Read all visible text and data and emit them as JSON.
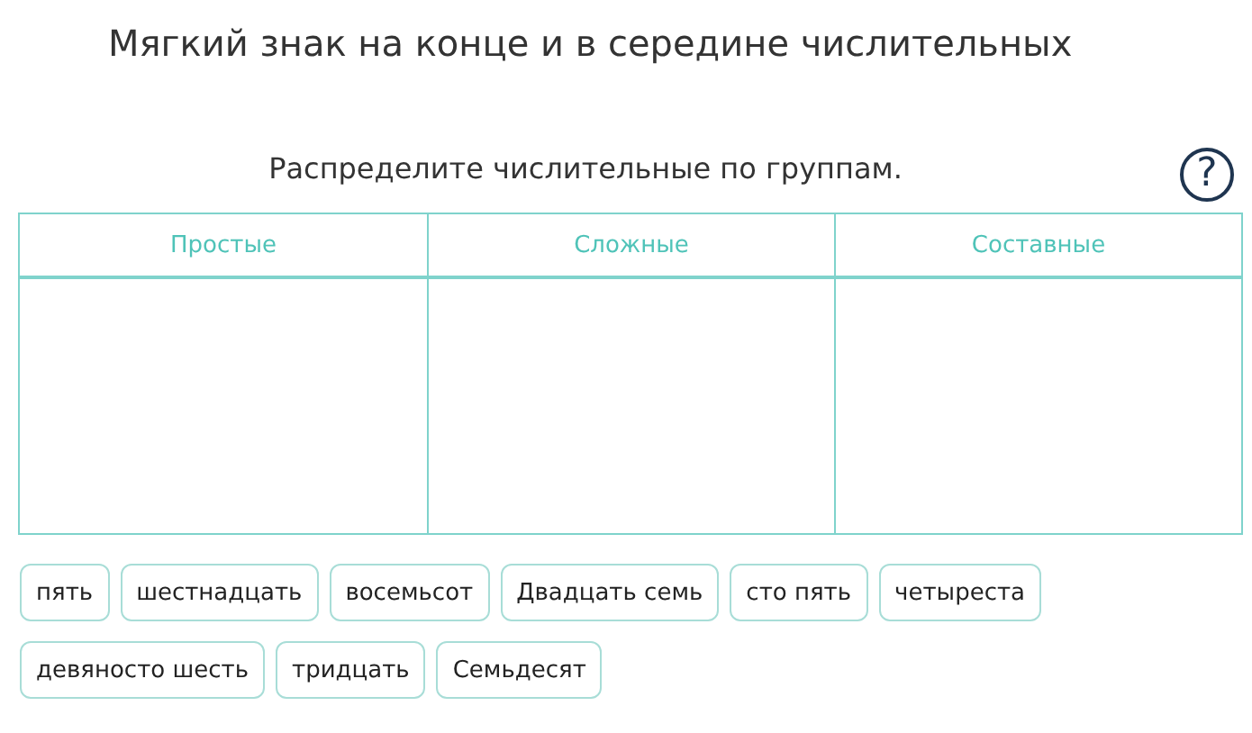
{
  "title": "Мягкий знак на конце и в середине числительных",
  "instruction": "Распределите числительные по группам.",
  "help": "?",
  "table": {
    "columns": [
      "Простые",
      "Сложные",
      "Составные"
    ]
  },
  "chips": [
    "пять",
    "шестнадцать",
    "восемьсот",
    "Двадцать семь",
    "сто пять",
    "четыреста",
    "девяносто шесть",
    "тридцать",
    "Семьдесят"
  ]
}
